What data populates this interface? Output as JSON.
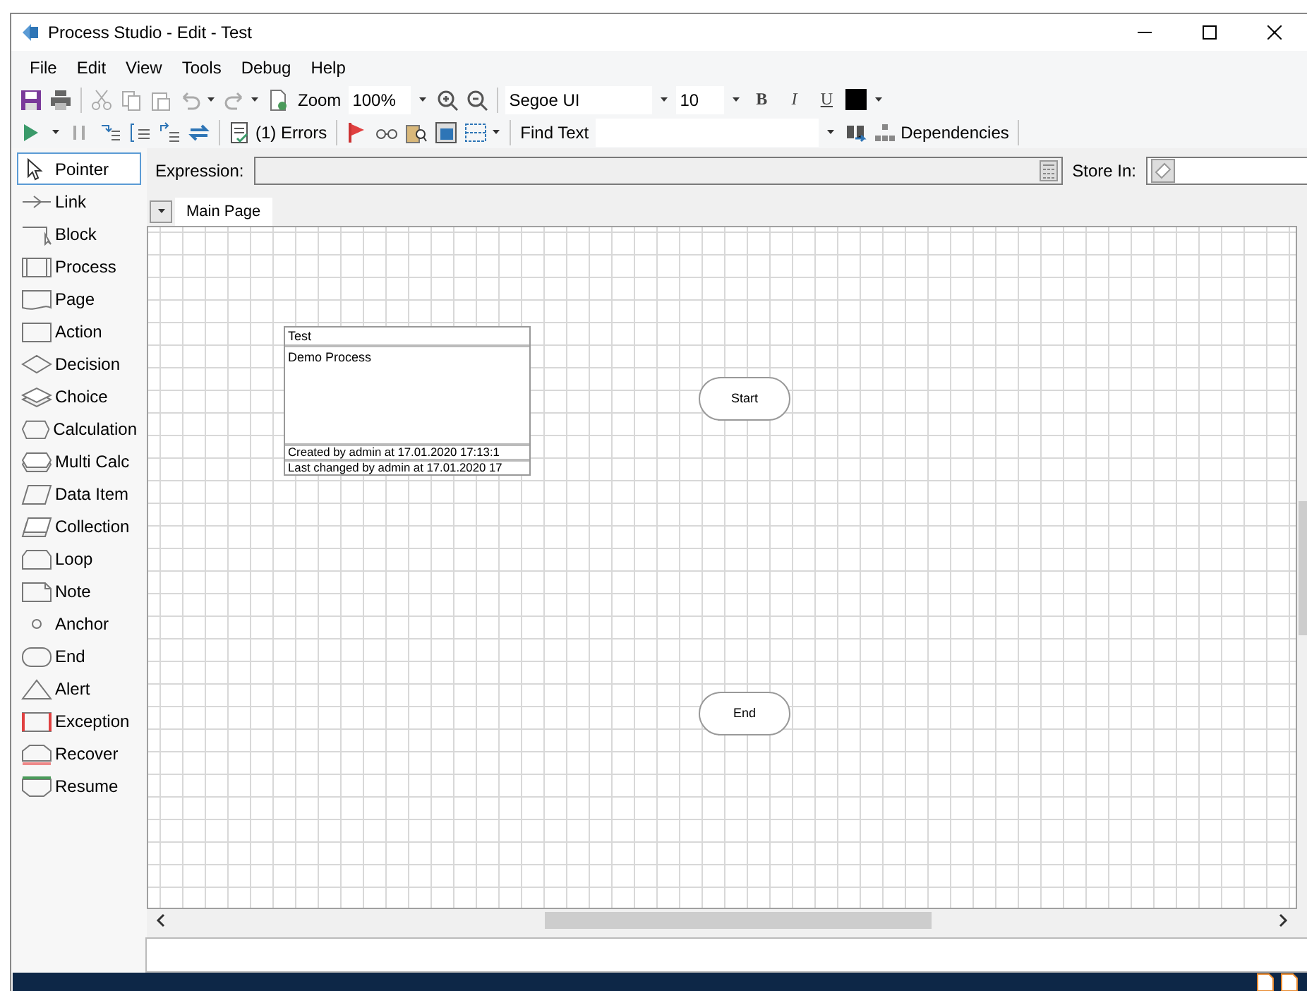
{
  "window": {
    "title": "Process Studio  - Edit - Test"
  },
  "menu": [
    "File",
    "Edit",
    "View",
    "Tools",
    "Debug",
    "Help"
  ],
  "toolbar": {
    "zoom_label": "Zoom",
    "zoom_value": "100%",
    "font_name": "Segoe UI",
    "font_size": "10",
    "bold": "B",
    "italic": "I",
    "underline": "U",
    "errors": "(1) Errors",
    "find_label": "Find Text",
    "dependencies": "Dependencies"
  },
  "palette": [
    {
      "label": "Pointer",
      "kind": "pointer",
      "selected": true
    },
    {
      "label": "Link",
      "kind": "link",
      "selected": false
    },
    {
      "label": "Block",
      "kind": "block",
      "selected": false
    },
    {
      "label": "Process",
      "kind": "process",
      "selected": false
    },
    {
      "label": "Page",
      "kind": "page",
      "selected": false
    },
    {
      "label": "Action",
      "kind": "action",
      "selected": false
    },
    {
      "label": "Decision",
      "kind": "decision",
      "selected": false
    },
    {
      "label": "Choice",
      "kind": "choice",
      "selected": false
    },
    {
      "label": "Calculation",
      "kind": "calculation",
      "selected": false
    },
    {
      "label": "Multi Calc",
      "kind": "multicalc",
      "selected": false
    },
    {
      "label": "Data Item",
      "kind": "dataitem",
      "selected": false
    },
    {
      "label": "Collection",
      "kind": "collection",
      "selected": false
    },
    {
      "label": "Loop",
      "kind": "loop",
      "selected": false
    },
    {
      "label": "Note",
      "kind": "note",
      "selected": false
    },
    {
      "label": "Anchor",
      "kind": "anchor",
      "selected": false
    },
    {
      "label": "End",
      "kind": "end",
      "selected": false
    },
    {
      "label": "Alert",
      "kind": "alert",
      "selected": false
    },
    {
      "label": "Exception",
      "kind": "exception",
      "selected": false
    },
    {
      "label": "Recover",
      "kind": "recover",
      "selected": false
    },
    {
      "label": "Resume",
      "kind": "resume",
      "selected": false
    }
  ],
  "expression": {
    "label": "Expression:",
    "store_label": "Store In:"
  },
  "page_tabs": [
    {
      "label": "Main Page",
      "selected": true
    }
  ],
  "canvas": {
    "info_box": {
      "title": "Test",
      "description": "Demo Process",
      "created": "Created by admin at 17.01.2020 17:13:1",
      "changed": "Last changed by admin at 17.01.2020 17"
    },
    "nodes": [
      {
        "kind": "start",
        "label": "Start"
      },
      {
        "kind": "end",
        "label": "End"
      }
    ]
  }
}
